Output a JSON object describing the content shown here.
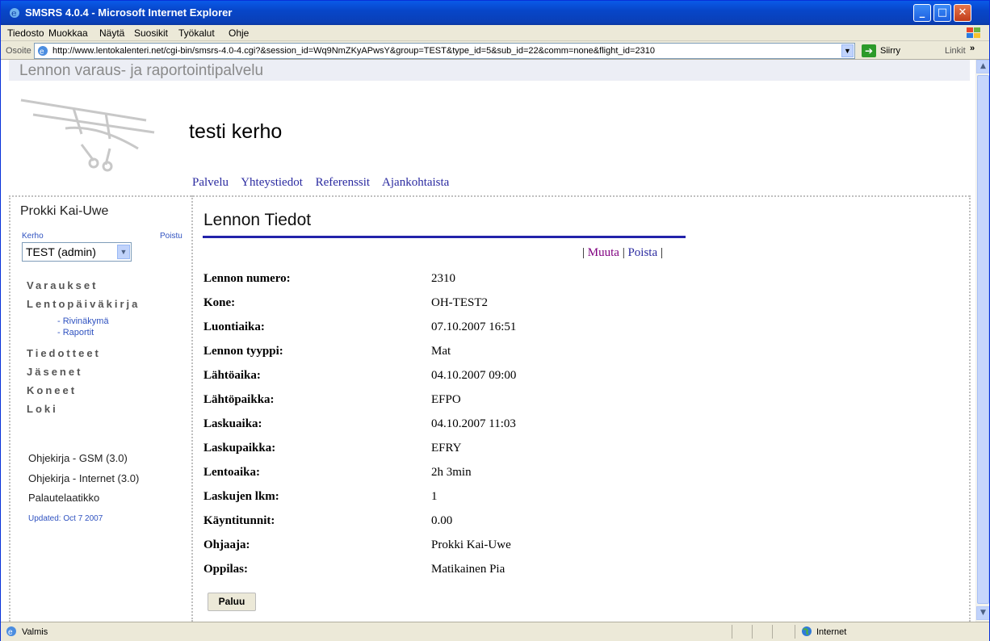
{
  "window": {
    "title": "SMSRS 4.0.4 - Microsoft Internet Explorer",
    "minimize": "_",
    "maximize": "□",
    "close": "✕"
  },
  "menu": [
    "Tiedosto",
    "Muokkaa",
    "Näytä",
    "Suosikit",
    "Työkalut",
    "Ohje"
  ],
  "address": {
    "label": "Osoite",
    "url": "http://www.lentokalenteri.net/cgi-bin/smsrs-4.0-4.cgi?&session_id=Wq9NmZKyAPwsY&group=TEST&type_id=5&sub_id=22&comm=none&flight_id=2310",
    "go": "Siirry",
    "links": "Linkit",
    "links_arrow": "»"
  },
  "page": {
    "banner": "Lennon varaus- ja raportointipalvelu",
    "club_name": "testi kerho",
    "top_nav": [
      "Palvelu",
      "Yhteystiedot",
      "Referenssit",
      "Ajankohtaista"
    ]
  },
  "sidebar": {
    "user": "Prokki Kai-Uwe",
    "kerho_label": "Kerho",
    "logout": "Poistu",
    "group_select": "TEST (admin)",
    "nav": [
      "Varaukset",
      "Lentopäiväkirja",
      "Tiedotteet",
      "Jäsenet",
      "Koneet",
      "Loki"
    ],
    "subnav": [
      "- Rivinäkymä",
      "- Raportit"
    ],
    "help": [
      "Ohjekirja - GSM (3.0)",
      "Ohjekirja - Internet (3.0)",
      "Palautelaatikko"
    ],
    "updated": "Updated: Oct 7 2007"
  },
  "main": {
    "title": "Lennon Tiedot",
    "actions": {
      "sep": "|",
      "edit": "Muuta",
      "delete": "Poista"
    },
    "fields": [
      {
        "label": "Lennon numero:",
        "value": "2310"
      },
      {
        "label": "Kone:",
        "value": "OH-TEST2"
      },
      {
        "label": "Luontiaika:",
        "value": "07.10.2007 16:51"
      },
      {
        "label": "Lennon tyyppi:",
        "value": "Mat"
      },
      {
        "label": "Lähtöaika:",
        "value": "04.10.2007 09:00"
      },
      {
        "label": "Lähtöpaikka:",
        "value": "EFPO"
      },
      {
        "label": "Laskuaika:",
        "value": "04.10.2007 11:03"
      },
      {
        "label": "Laskupaikka:",
        "value": "EFRY"
      },
      {
        "label": "Lentoaika:",
        "value": "2h 3min"
      },
      {
        "label": "Laskujen lkm:",
        "value": "1"
      },
      {
        "label": "Käyntitunnit:",
        "value": "0.00"
      },
      {
        "label": "Ohjaaja:",
        "value": "Prokki Kai-Uwe"
      },
      {
        "label": "Oppilas:",
        "value": "Matikainen Pia"
      }
    ],
    "back_button": "Paluu"
  },
  "status": {
    "text": "Valmis",
    "zone": "Internet"
  },
  "icons": {
    "ie": "ie-icon",
    "windows": "windows-logo-icon",
    "go": "go-arrow-icon",
    "globe": "globe-icon",
    "page": "page-icon"
  }
}
